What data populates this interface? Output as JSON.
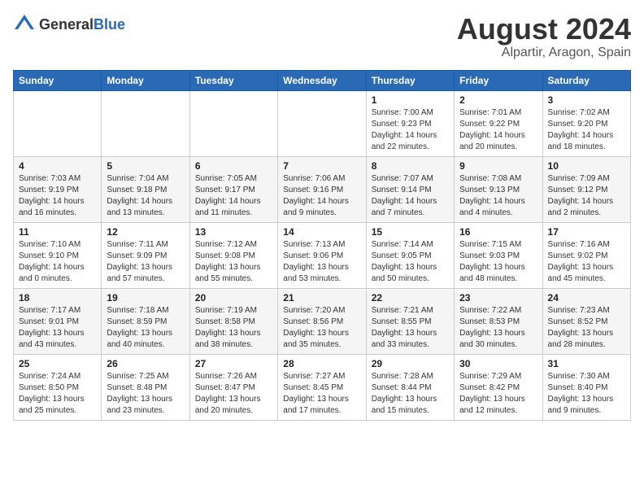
{
  "header": {
    "logo_general": "General",
    "logo_blue": "Blue",
    "main_title": "August 2024",
    "subtitle": "Alpartir, Aragon, Spain"
  },
  "weekdays": [
    "Sunday",
    "Monday",
    "Tuesday",
    "Wednesday",
    "Thursday",
    "Friday",
    "Saturday"
  ],
  "weeks": [
    [
      {
        "day": "",
        "info": ""
      },
      {
        "day": "",
        "info": ""
      },
      {
        "day": "",
        "info": ""
      },
      {
        "day": "",
        "info": ""
      },
      {
        "day": "1",
        "info": "Sunrise: 7:00 AM\nSunset: 9:23 PM\nDaylight: 14 hours\nand 22 minutes."
      },
      {
        "day": "2",
        "info": "Sunrise: 7:01 AM\nSunset: 9:22 PM\nDaylight: 14 hours\nand 20 minutes."
      },
      {
        "day": "3",
        "info": "Sunrise: 7:02 AM\nSunset: 9:20 PM\nDaylight: 14 hours\nand 18 minutes."
      }
    ],
    [
      {
        "day": "4",
        "info": "Sunrise: 7:03 AM\nSunset: 9:19 PM\nDaylight: 14 hours\nand 16 minutes."
      },
      {
        "day": "5",
        "info": "Sunrise: 7:04 AM\nSunset: 9:18 PM\nDaylight: 14 hours\nand 13 minutes."
      },
      {
        "day": "6",
        "info": "Sunrise: 7:05 AM\nSunset: 9:17 PM\nDaylight: 14 hours\nand 11 minutes."
      },
      {
        "day": "7",
        "info": "Sunrise: 7:06 AM\nSunset: 9:16 PM\nDaylight: 14 hours\nand 9 minutes."
      },
      {
        "day": "8",
        "info": "Sunrise: 7:07 AM\nSunset: 9:14 PM\nDaylight: 14 hours\nand 7 minutes."
      },
      {
        "day": "9",
        "info": "Sunrise: 7:08 AM\nSunset: 9:13 PM\nDaylight: 14 hours\nand 4 minutes."
      },
      {
        "day": "10",
        "info": "Sunrise: 7:09 AM\nSunset: 9:12 PM\nDaylight: 14 hours\nand 2 minutes."
      }
    ],
    [
      {
        "day": "11",
        "info": "Sunrise: 7:10 AM\nSunset: 9:10 PM\nDaylight: 14 hours\nand 0 minutes."
      },
      {
        "day": "12",
        "info": "Sunrise: 7:11 AM\nSunset: 9:09 PM\nDaylight: 13 hours\nand 57 minutes."
      },
      {
        "day": "13",
        "info": "Sunrise: 7:12 AM\nSunset: 9:08 PM\nDaylight: 13 hours\nand 55 minutes."
      },
      {
        "day": "14",
        "info": "Sunrise: 7:13 AM\nSunset: 9:06 PM\nDaylight: 13 hours\nand 53 minutes."
      },
      {
        "day": "15",
        "info": "Sunrise: 7:14 AM\nSunset: 9:05 PM\nDaylight: 13 hours\nand 50 minutes."
      },
      {
        "day": "16",
        "info": "Sunrise: 7:15 AM\nSunset: 9:03 PM\nDaylight: 13 hours\nand 48 minutes."
      },
      {
        "day": "17",
        "info": "Sunrise: 7:16 AM\nSunset: 9:02 PM\nDaylight: 13 hours\nand 45 minutes."
      }
    ],
    [
      {
        "day": "18",
        "info": "Sunrise: 7:17 AM\nSunset: 9:01 PM\nDaylight: 13 hours\nand 43 minutes."
      },
      {
        "day": "19",
        "info": "Sunrise: 7:18 AM\nSunset: 8:59 PM\nDaylight: 13 hours\nand 40 minutes."
      },
      {
        "day": "20",
        "info": "Sunrise: 7:19 AM\nSunset: 8:58 PM\nDaylight: 13 hours\nand 38 minutes."
      },
      {
        "day": "21",
        "info": "Sunrise: 7:20 AM\nSunset: 8:56 PM\nDaylight: 13 hours\nand 35 minutes."
      },
      {
        "day": "22",
        "info": "Sunrise: 7:21 AM\nSunset: 8:55 PM\nDaylight: 13 hours\nand 33 minutes."
      },
      {
        "day": "23",
        "info": "Sunrise: 7:22 AM\nSunset: 8:53 PM\nDaylight: 13 hours\nand 30 minutes."
      },
      {
        "day": "24",
        "info": "Sunrise: 7:23 AM\nSunset: 8:52 PM\nDaylight: 13 hours\nand 28 minutes."
      }
    ],
    [
      {
        "day": "25",
        "info": "Sunrise: 7:24 AM\nSunset: 8:50 PM\nDaylight: 13 hours\nand 25 minutes."
      },
      {
        "day": "26",
        "info": "Sunrise: 7:25 AM\nSunset: 8:48 PM\nDaylight: 13 hours\nand 23 minutes."
      },
      {
        "day": "27",
        "info": "Sunrise: 7:26 AM\nSunset: 8:47 PM\nDaylight: 13 hours\nand 20 minutes."
      },
      {
        "day": "28",
        "info": "Sunrise: 7:27 AM\nSunset: 8:45 PM\nDaylight: 13 hours\nand 17 minutes."
      },
      {
        "day": "29",
        "info": "Sunrise: 7:28 AM\nSunset: 8:44 PM\nDaylight: 13 hours\nand 15 minutes."
      },
      {
        "day": "30",
        "info": "Sunrise: 7:29 AM\nSunset: 8:42 PM\nDaylight: 13 hours\nand 12 minutes."
      },
      {
        "day": "31",
        "info": "Sunrise: 7:30 AM\nSunset: 8:40 PM\nDaylight: 13 hours\nand 9 minutes."
      }
    ]
  ]
}
